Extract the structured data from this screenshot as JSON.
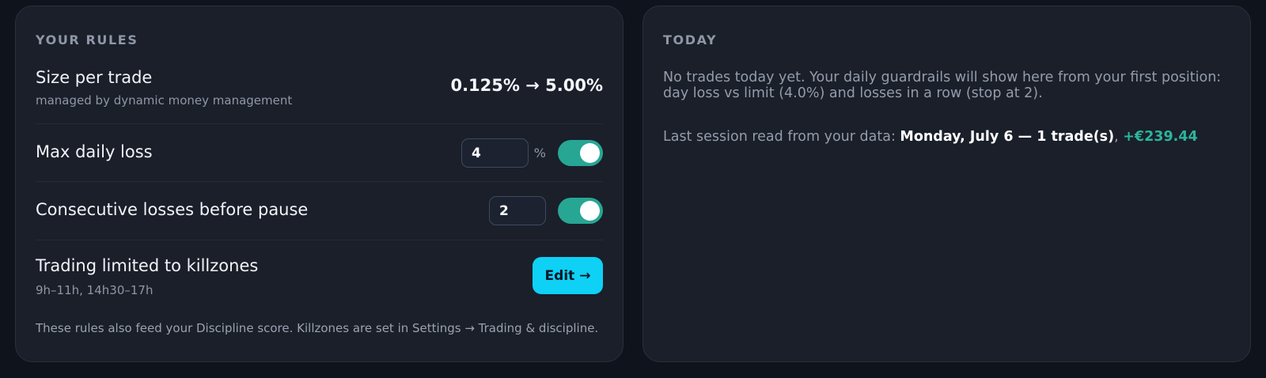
{
  "rules": {
    "title": "YOUR RULES",
    "size_per_trade": {
      "label": "Size per trade",
      "sub": "managed by dynamic money management",
      "value": "0.125% → 5.00%"
    },
    "max_daily_loss": {
      "label": "Max daily loss",
      "value": "4",
      "unit": "%",
      "enabled": true
    },
    "consecutive_losses": {
      "label": "Consecutive losses before pause",
      "value": "2",
      "enabled": true
    },
    "killzones": {
      "label": "Trading limited to killzones",
      "sub": "9h–11h, 14h30–17h",
      "edit_label": "Edit →"
    },
    "footnote": "These rules also feed your Discipline score. Killzones are set in Settings → Trading & discipline."
  },
  "today": {
    "title": "TODAY",
    "message": "No trades today yet. Your daily guardrails will show here from your first position: day loss vs limit (4.0%) and losses in a row (stop at 2).",
    "last_session_prefix": "Last session read from your data: ",
    "last_session_day": "Monday, July 6 — 1 trade(s)",
    "separator": ", ",
    "last_session_pnl": "+€239.44"
  },
  "colors": {
    "accent": "#0fd0f5",
    "toggle_on": "#27a694",
    "profit": "#2bb59c"
  }
}
